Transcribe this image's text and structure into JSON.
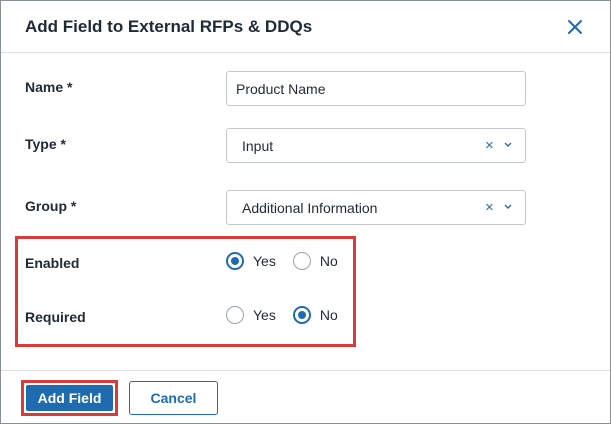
{
  "dialog": {
    "title": "Add Field to External RFPs & DDQs",
    "close_icon": "close-icon"
  },
  "form": {
    "name": {
      "label": "Name *",
      "value": "Product Name"
    },
    "type": {
      "label": "Type *",
      "value": "Input",
      "clear_glyph": "×"
    },
    "group": {
      "label": "Group *",
      "value": "Additional Information",
      "clear_glyph": "×"
    },
    "enabled": {
      "label": "Enabled",
      "options": [
        "Yes",
        "No"
      ],
      "selected": "Yes"
    },
    "required": {
      "label": "Required",
      "options": [
        "Yes",
        "No"
      ],
      "selected": "No"
    }
  },
  "footer": {
    "primary_label": "Add Field",
    "secondary_label": "Cancel"
  },
  "colors": {
    "accent": "#1e6bb0",
    "highlight": "#d93a3a"
  }
}
